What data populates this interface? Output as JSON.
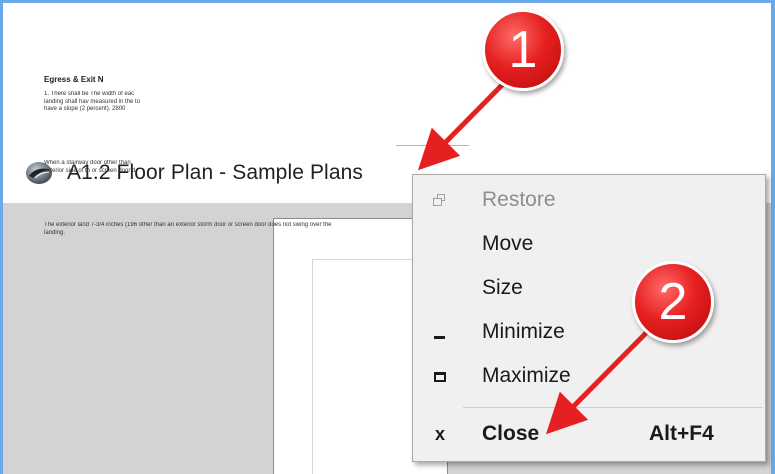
{
  "window": {
    "title": "A1.2 Floor Plan - Sample Plans",
    "app_icon": "app-logo-icon"
  },
  "document": {
    "heading": "Egress & Exit N",
    "paragraphs": [
      "1. There shall be The width of eac landing shall hav measured in the to have a slope (2 percent). 2800",
      "When a stairway door other than exterior side of th or screen door d",
      "The exterior land 7-3/4 inches (196 other than an exterior storm door or screen door does not swing over the landing."
    ]
  },
  "context_menu": {
    "items": [
      {
        "label": "Restore",
        "icon": "restore-icon",
        "enabled": false,
        "shortcut": ""
      },
      {
        "label": "Move",
        "icon": "",
        "enabled": true,
        "shortcut": ""
      },
      {
        "label": "Size",
        "icon": "",
        "enabled": true,
        "shortcut": ""
      },
      {
        "label": "Minimize",
        "icon": "minimize-icon",
        "enabled": true,
        "shortcut": ""
      },
      {
        "label": "Maximize",
        "icon": "maximize-icon",
        "enabled": true,
        "shortcut": ""
      },
      {
        "label": "Close",
        "icon": "close-icon",
        "enabled": true,
        "shortcut": "Alt+F4"
      }
    ]
  },
  "callouts": [
    {
      "number": "1"
    },
    {
      "number": "2"
    }
  ],
  "colors": {
    "callout_red": "#e62020",
    "arrow_red": "#e52020",
    "window_border": "#6aa9e8",
    "menu_background": "#f0f0f0"
  }
}
